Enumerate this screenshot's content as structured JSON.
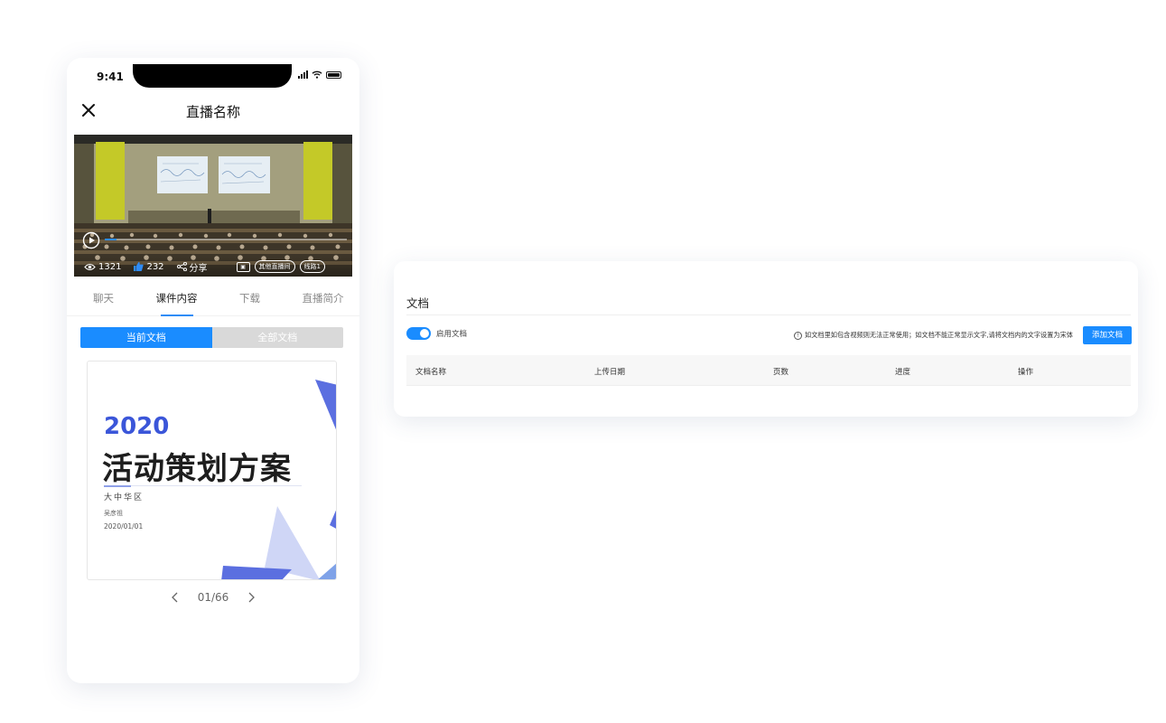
{
  "phone": {
    "status": {
      "time": "9:41"
    },
    "nav": {
      "title": "直播名称",
      "close_icon": "close-icon"
    },
    "video": {
      "progress_fraction": 0.05,
      "views": "1321",
      "likes": "232",
      "share_label": "分享",
      "other_live_label": "其他直播间",
      "line_label": "线路1"
    },
    "tabs": [
      "聊天",
      "课件内容",
      "下载",
      "直播简介"
    ],
    "active_tab": "课件内容",
    "doc_switch": {
      "current": "当前文档",
      "all": "全部文档"
    },
    "slide": {
      "year": "2020",
      "title": "活动策划方案",
      "region": "大中华区",
      "author": "吴彦祖",
      "date": "2020/01/01"
    },
    "pager": {
      "text": "01/66"
    }
  },
  "doc_panel": {
    "title": "文档",
    "enable_label": "启用文档",
    "enabled": true,
    "notice": "如文档里如包含视频则无法正常使用；如文档不能正常显示文字,请将文档内的文字设置为宋体",
    "add_button": "添加文档",
    "columns": [
      "文档名称",
      "上传日期",
      "页数",
      "进度",
      "操作"
    ]
  },
  "colors": {
    "accent": "#1a8cff",
    "slide_blue": "#3b56d9"
  }
}
